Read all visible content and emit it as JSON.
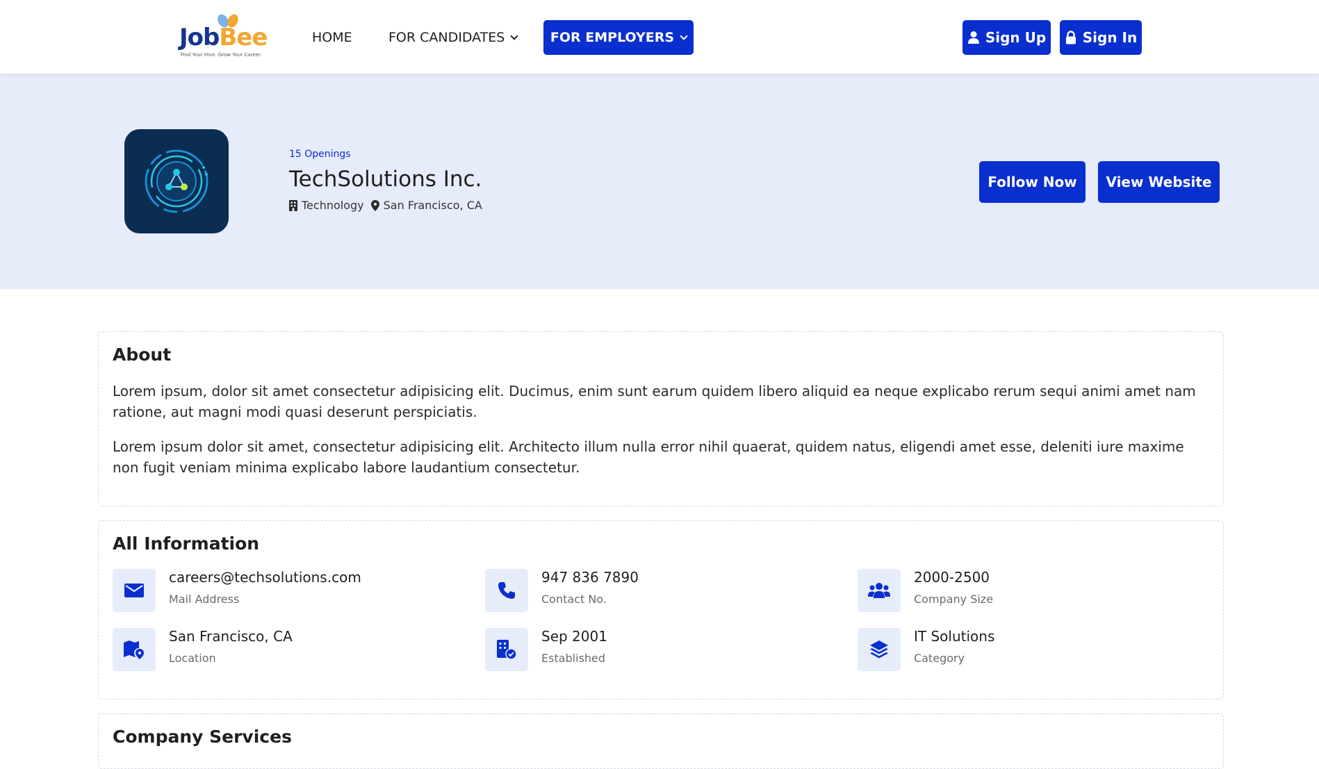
{
  "brand": {
    "name_part1": "Job",
    "name_part2": "Bee",
    "tagline": "Find Your Hive. Grow Your Career.",
    "primary_color": "#0a2fcf",
    "accent_color": "#f3a632",
    "hero_bg": "#e6ecfa"
  },
  "nav": {
    "home": "HOME",
    "candidates": "FOR CANDIDATES",
    "employers": "FOR EMPLOYERS"
  },
  "auth": {
    "signup": "Sign Up",
    "signin": "Sign In"
  },
  "company": {
    "openings": "15 Openings",
    "name": "TechSolutions Inc.",
    "industry": "Technology",
    "location": "San Francisco, CA",
    "follow_label": "Follow Now",
    "website_label": "View Website"
  },
  "about": {
    "title": "About",
    "paragraphs": [
      "Lorem ipsum, dolor sit amet consectetur adipisicing elit. Ducimus, enim sunt earum quidem libero aliquid ea neque explicabo rerum sequi animi amet nam ratione, aut magni modi quasi deserunt perspiciatis.",
      "Lorem ipsum dolor sit amet, consectetur adipisicing elit. Architecto illum nulla error nihil quaerat, quidem natus, eligendi amet esse, deleniti iure maxime non fugit veniam minima explicabo labore laudantium consectetur."
    ]
  },
  "info": {
    "title": "All Information",
    "items": [
      {
        "icon": "mail-icon",
        "value": "careers@techsolutions.com",
        "label": "Mail Address"
      },
      {
        "icon": "phone-icon",
        "value": "947 836 7890",
        "label": "Contact No."
      },
      {
        "icon": "users-icon",
        "value": "2000-2500",
        "label": "Company Size"
      },
      {
        "icon": "map-pin-icon",
        "value": "San Francisco, CA",
        "label": "Location"
      },
      {
        "icon": "building-check-icon",
        "value": "Sep 2001",
        "label": "Established"
      },
      {
        "icon": "layers-icon",
        "value": "IT Solutions",
        "label": "Category"
      }
    ]
  },
  "services": {
    "title": "Company Services"
  }
}
